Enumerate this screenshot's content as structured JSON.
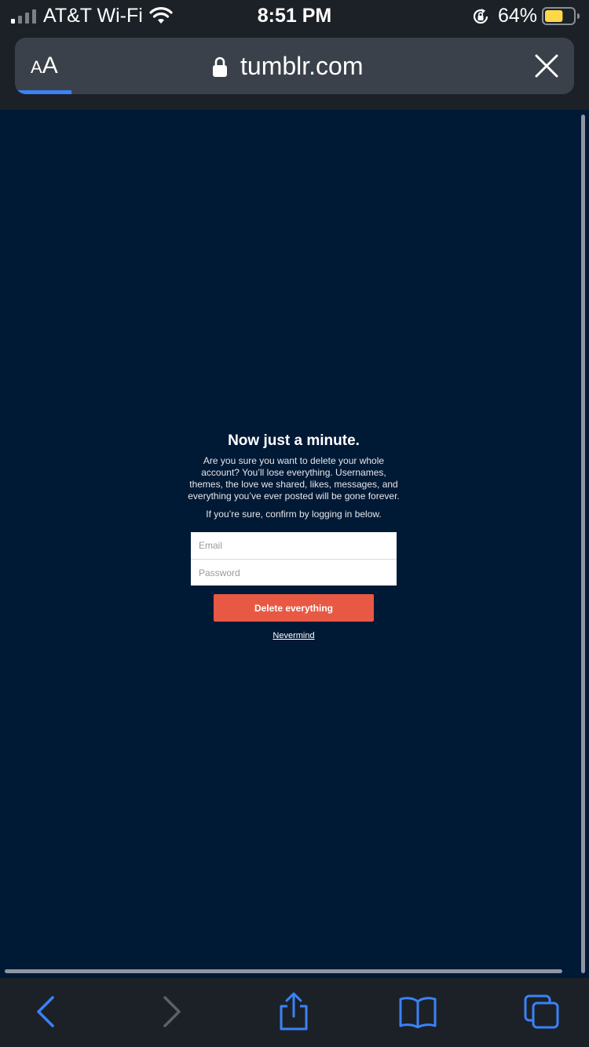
{
  "status_bar": {
    "carrier": "AT&T Wi-Fi",
    "time": "8:51 PM",
    "battery_percent": "64%",
    "battery_level": 0.64,
    "battery_color": "#ffd84a"
  },
  "browser": {
    "text_size_label_small": "A",
    "text_size_label_large": "A",
    "url": "tumblr.com",
    "accent_color": "#3a82f7"
  },
  "dialog": {
    "title": "Now just a minute.",
    "body": "Are you sure you want to delete your whole account? You’ll lose everything. Usernames, themes, the love we shared, likes, messages, and everything you’ve ever posted will be gone forever.",
    "hint": "If you’re sure, confirm by logging in below.",
    "email_placeholder": "Email",
    "password_placeholder": "Password",
    "delete_label": "Delete everything",
    "nevermind_label": "Nevermind",
    "delete_color": "#e75944"
  },
  "toolbar": {
    "icons": [
      "back-icon",
      "forward-icon",
      "share-icon",
      "bookmarks-icon",
      "tabs-icon"
    ]
  }
}
